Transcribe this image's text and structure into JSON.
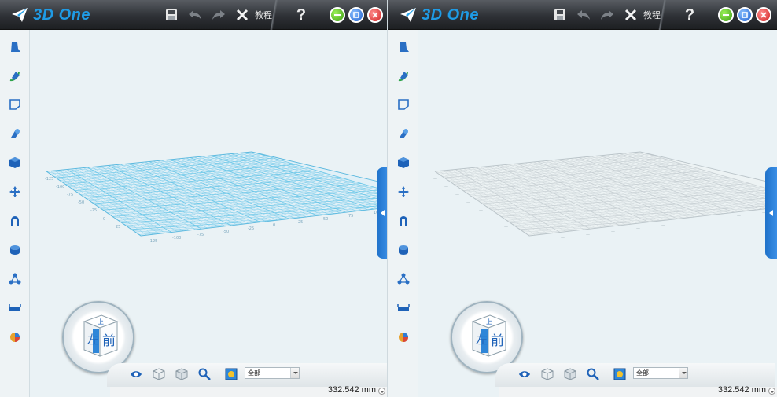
{
  "app": {
    "logo_text": "3D One",
    "tutorial_label": "教程",
    "help_label": "?"
  },
  "sidebar_tools": [
    "sketch-tool-icon",
    "draw-curve-tool-icon",
    "basic-shape-tool-icon",
    "feature-tool-icon",
    "solid-edit-tool-icon",
    "move-tool-icon",
    "magnet-tool-icon",
    "combine-tool-icon",
    "pattern-tool-icon",
    "measure-tool-icon",
    "material-tool-icon"
  ],
  "viewcube": {
    "left_face": "左",
    "front_face": "前",
    "top_face": "上"
  },
  "bottom_toolbar": {
    "filter_value": "全部",
    "scale_readout": "332.542 mm"
  },
  "axis_ticks_left_pane": [
    "-125",
    "-100",
    "-75",
    "-50",
    "-25",
    "0",
    "25",
    "50",
    "75",
    "100",
    "125"
  ],
  "panes": [
    {
      "id": "left",
      "grid_color": "#6cc7e8"
    },
    {
      "id": "right",
      "grid_color": "#c8d0d4"
    }
  ]
}
